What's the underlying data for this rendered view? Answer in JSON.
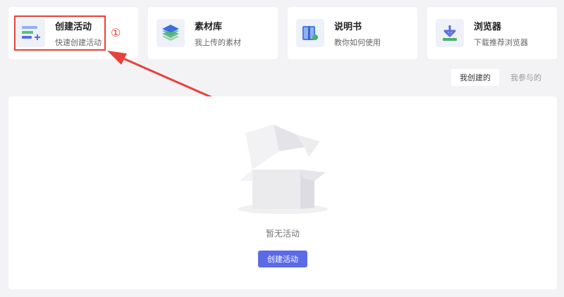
{
  "cards": [
    {
      "title": "创建活动",
      "subtitle": "快速创建活动",
      "icon": "create-activity-icon"
    },
    {
      "title": "素材库",
      "subtitle": "我上传的素材",
      "icon": "layers-icon"
    },
    {
      "title": "说明书",
      "subtitle": "教你如何使用",
      "icon": "book-icon"
    },
    {
      "title": "浏览器",
      "subtitle": "下载推荐浏览器",
      "icon": "download-icon"
    }
  ],
  "annotation": {
    "marker": "①",
    "color": "#e8413b"
  },
  "filters": {
    "active": "我创建的",
    "inactive": "我参与的"
  },
  "empty_state": {
    "message": "暂无活动",
    "button_label": "创建活动",
    "illustration": "empty-box-icon"
  },
  "colors": {
    "accent": "#5b6be6",
    "annotation": "#e8413b",
    "background": "#f3f3f5"
  }
}
